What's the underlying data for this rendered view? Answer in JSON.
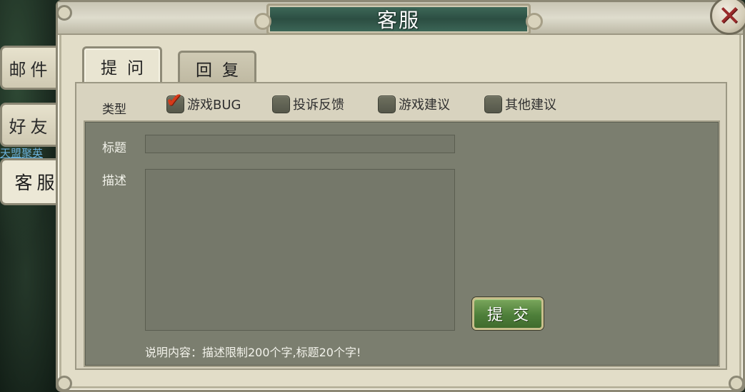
{
  "background": {
    "link_text": "天盟聚英"
  },
  "window": {
    "title": "客服",
    "close_icon": "close-x-icon"
  },
  "side_tabs": [
    {
      "label": "邮件",
      "active": false
    },
    {
      "label": "好友",
      "active": false
    },
    {
      "label": "客服",
      "active": true
    }
  ],
  "tabs": [
    {
      "label": "提问",
      "active": true
    },
    {
      "label": "回复",
      "active": false
    }
  ],
  "type_row": {
    "label": "类型",
    "options": [
      {
        "label": "游戏BUG",
        "checked": true
      },
      {
        "label": "投诉反馈",
        "checked": false
      },
      {
        "label": "游戏建议",
        "checked": false
      },
      {
        "label": "其他建议",
        "checked": false
      }
    ]
  },
  "form": {
    "title_label": "标题",
    "title_value": "",
    "desc_label": "描述",
    "desc_value": "",
    "submit_label": "提交",
    "hint": "说明内容：描述限制200个字,标题20个字!"
  },
  "colors": {
    "accent_checkmark": "#d63a1a",
    "submit_green": "#4e7f3a",
    "title_plate": "#2c4e42"
  }
}
